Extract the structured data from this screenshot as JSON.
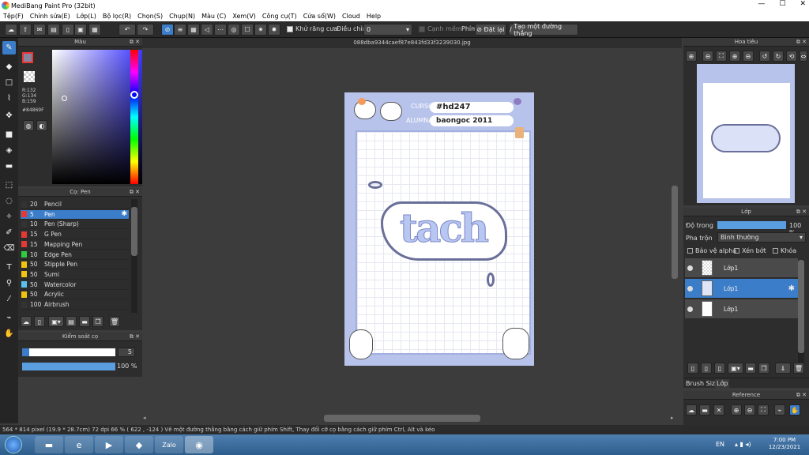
{
  "window": {
    "title": "MediBang Paint Pro (32bit)",
    "min": "—",
    "max": "☐",
    "close": "✕"
  },
  "menu": [
    "Tệp(F)",
    "Chỉnh sửa(E)",
    "Lớp(L)",
    "Bộ lọc(R)",
    "Chọn(S)",
    "Chụp(N)",
    "Màu (C)",
    "Xem(V)",
    "Công cụ(T)",
    "Cửa sổ(W)",
    "Cloud",
    "Help"
  ],
  "toolbar": {
    "antialias": "Khử răng cưa",
    "adjust_label": "Điều chỉnh",
    "adjust_value": "0",
    "edge": "Cạnh mềm",
    "key_label": "Phím",
    "reset": "Đặt lại",
    "straight": "Tạo một đường thẳng"
  },
  "file": {
    "name": "088dba9344caef87e843fd33f3239030.jpg"
  },
  "color_panel": {
    "title": "Màu",
    "r": "R:132",
    "g": "G:134",
    "b": "B:159",
    "hex": "#84869F",
    "color": "#84869f"
  },
  "brush_panel": {
    "title": "Cọ: Pen",
    "items": [
      {
        "size": "20",
        "name": "Pencil",
        "color": "#333333"
      },
      {
        "size": "5",
        "name": "Pen",
        "color": "#e53935",
        "selected": true
      },
      {
        "size": "10",
        "name": "Pen (Sharp)",
        "color": "#333333"
      },
      {
        "size": "15",
        "name": "G Pen",
        "color": "#e53935"
      },
      {
        "size": "15",
        "name": "Mapping Pen",
        "color": "#e53935"
      },
      {
        "size": "10",
        "name": "Edge Pen",
        "color": "#2ecc40"
      },
      {
        "size": "50",
        "name": "Stipple Pen",
        "color": "#f1c40f"
      },
      {
        "size": "50",
        "name": "Sumi",
        "color": "#f1c40f"
      },
      {
        "size": "50",
        "name": "Watercolor",
        "color": "#5bc0eb"
      },
      {
        "size": "50",
        "name": "Acrylic",
        "color": "#f1c40f"
      },
      {
        "size": "100",
        "name": "Airbrush",
        "color": "#333333"
      }
    ]
  },
  "brush_control": {
    "title": "Kiểm soát cọ",
    "size": "5",
    "opacity": "100 %",
    "opacity_value": 1.0
  },
  "navigator": {
    "title": "Hoa tiêu"
  },
  "layer_panel": {
    "title": "Lớp",
    "opacity_label": "Độ trong",
    "opacity": "100 %",
    "opacity_value": 1.0,
    "blend_label": "Pha trộn",
    "blend": "Bình thường",
    "protect_alpha": "Bảo vệ alpha",
    "clipping": "Xén bớt",
    "lock": "Khóa",
    "layers": [
      {
        "name": "Lớp1"
      },
      {
        "name": "Lớp1",
        "selected": true
      },
      {
        "name": "Lớp1"
      }
    ]
  },
  "tabs": {
    "brush_size": "Brush Size",
    "layer": "Lớp"
  },
  "reference": {
    "title": "Reference"
  },
  "artwork": {
    "curso": "CURSO",
    "alumna": "ALUMNA",
    "code": "#hd247",
    "student": "baongoc 2011",
    "word": "tach"
  },
  "status": "564 * 814 pixel   (19.9 * 28.7cm)   72 dpi   66 %   ( 622 , -124 )   Vẽ một đường thẳng bằng cách giữ phím Shift, Thay đổi cỡ cọ bằng cách giữ phím Ctrl, Alt và kéo",
  "taskbar": {
    "lang": "EN",
    "time": "7:00 PM",
    "date": "12/23/2021",
    "zalo": "Zalo"
  }
}
